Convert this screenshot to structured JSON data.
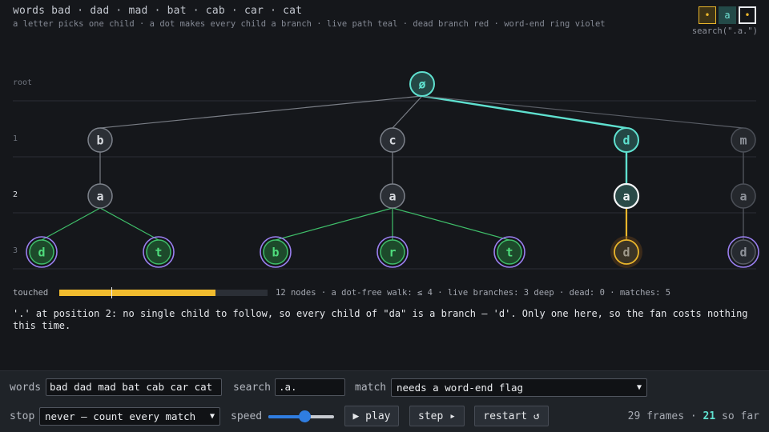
{
  "header": {
    "title": "words bad · dad · mad · bat · cab · car · cat",
    "subtitle": "a letter picks one child · a dot makes every child a branch · live path teal · dead branch red · word-end ring violet"
  },
  "pattern": {
    "cells": [
      "•",
      "a",
      "•"
    ],
    "label": "search(\".a.\")"
  },
  "depth_labels": [
    "root",
    "1",
    "2",
    "3"
  ],
  "active_depth": 2,
  "tree": {
    "nodes": [
      {
        "id": "root",
        "label": "ø",
        "depth": 0,
        "col": 3,
        "state": "path"
      },
      {
        "id": "b",
        "label": "b",
        "depth": 1,
        "col": 0,
        "state": "normal"
      },
      {
        "id": "c",
        "label": "c",
        "depth": 1,
        "col": 2,
        "state": "normal"
      },
      {
        "id": "d",
        "label": "d",
        "depth": 1,
        "col": 4,
        "state": "path"
      },
      {
        "id": "m",
        "label": "m",
        "depth": 1,
        "col": 5,
        "state": "dim"
      },
      {
        "id": "ba",
        "label": "a",
        "depth": 2,
        "col": 0,
        "state": "normal"
      },
      {
        "id": "ca",
        "label": "a",
        "depth": 2,
        "col": 2,
        "state": "normal"
      },
      {
        "id": "da",
        "label": "a",
        "depth": 2,
        "col": 4,
        "state": "current"
      },
      {
        "id": "ma",
        "label": "a",
        "depth": 2,
        "col": 5,
        "state": "dim"
      },
      {
        "id": "bad",
        "label": "d",
        "depth": 3,
        "col": -1,
        "state": "match"
      },
      {
        "id": "bat",
        "label": "t",
        "depth": 3,
        "col": 1,
        "state": "match"
      },
      {
        "id": "cab",
        "label": "b",
        "depth": 3,
        "col": 1.5,
        "state": "match"
      },
      {
        "id": "car",
        "label": "r",
        "depth": 3,
        "col": 2,
        "state": "match"
      },
      {
        "id": "cat",
        "label": "t",
        "depth": 3,
        "col": 2.5,
        "state": "match"
      },
      {
        "id": "dad",
        "label": "d",
        "depth": 3,
        "col": 4,
        "state": "probe"
      },
      {
        "id": "mad",
        "label": "d",
        "depth": 3,
        "col": 5,
        "state": "wordend"
      }
    ],
    "edges": [
      {
        "from": "root",
        "to": "b",
        "state": "normal"
      },
      {
        "from": "root",
        "to": "c",
        "state": "normal"
      },
      {
        "from": "root",
        "to": "d",
        "state": "path"
      },
      {
        "from": "root",
        "to": "m",
        "state": "dim"
      },
      {
        "from": "b",
        "to": "ba",
        "state": "normal"
      },
      {
        "from": "c",
        "to": "ca",
        "state": "normal"
      },
      {
        "from": "d",
        "to": "da",
        "state": "path"
      },
      {
        "from": "m",
        "to": "ma",
        "state": "dim"
      },
      {
        "from": "ba",
        "to": "bad",
        "state": "match"
      },
      {
        "from": "ba",
        "to": "bat",
        "state": "match"
      },
      {
        "from": "ca",
        "to": "cab",
        "state": "match"
      },
      {
        "from": "ca",
        "to": "car",
        "state": "match"
      },
      {
        "from": "ca",
        "to": "cat",
        "state": "match"
      },
      {
        "from": "da",
        "to": "dad",
        "state": "probe"
      },
      {
        "from": "ma",
        "to": "mad",
        "state": "dim"
      }
    ]
  },
  "touched": {
    "label": "touched",
    "fraction": 0.75,
    "marker_fraction": 0.25,
    "stats": "12 nodes · a dot-free walk: ≤ 4 · live branches: 3 deep · dead: 0 · matches: 5"
  },
  "narration": "'.' at position 2: no single child to follow, so every child of \"da\" is a branch — 'd'. Only one here, so the fan costs nothing this time.",
  "controls": {
    "words_label": "words",
    "words_value": "bad dad mad bat cab car cat",
    "search_label": "search",
    "search_value": ".a.",
    "match_label": "match",
    "match_value": "needs a word-end flag",
    "stop_label": "stop",
    "stop_value": "never — count every match",
    "speed_label": "speed",
    "speed_fraction": 0.55,
    "play_label": "▶ play",
    "step_label": "step ▸",
    "restart_label": "restart ↺",
    "frames_total": "29 frames · ",
    "frames_so_far": "21",
    "frames_suffix": " so far"
  },
  "colors": {
    "teal": "#5fe0cf",
    "match_green": "#3fbf6a",
    "probe_gold": "#e9b52b",
    "wordend_violet": "#9a7ff0",
    "node_fill": "#2b2f35",
    "bar": "#f0bb2e"
  }
}
